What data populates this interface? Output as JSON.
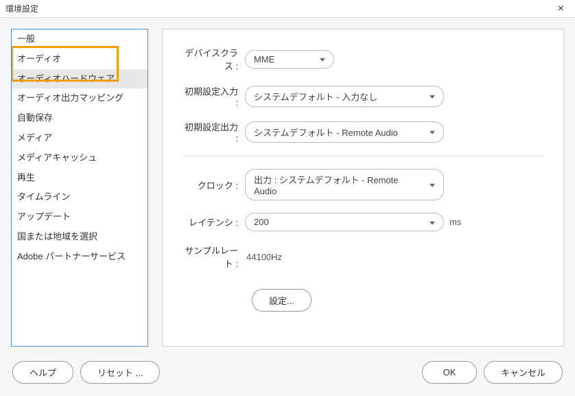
{
  "window": {
    "title": "環境設定"
  },
  "sidebar": {
    "items": [
      {
        "label": "一般"
      },
      {
        "label": "オーディオ"
      },
      {
        "label": "オーディオハードウェア"
      },
      {
        "label": "オーディオ出力マッピング"
      },
      {
        "label": "自動保存"
      },
      {
        "label": "メディア"
      },
      {
        "label": "メディアキャッシュ"
      },
      {
        "label": "再生"
      },
      {
        "label": "タイムライン"
      },
      {
        "label": "アップデート"
      },
      {
        "label": "国または地域を選択"
      },
      {
        "label": "Adobe パートナーサービス"
      }
    ]
  },
  "panel": {
    "deviceClass": {
      "label": "デバイスクラス :",
      "value": "MME"
    },
    "defaultInput": {
      "label": "初期設定入力 :",
      "value": "システムデフォルト - 入力なし"
    },
    "defaultOutput": {
      "label": "初期設定出力 :",
      "value": "システムデフォルト - Remote Audio"
    },
    "clock": {
      "label": "クロック :",
      "value": "出力 : システムデフォルト - Remote Audio"
    },
    "latency": {
      "label": "レイテンシ :",
      "value": "200",
      "unit": "ms"
    },
    "sampleRate": {
      "label": "サンプルレート :",
      "value": "44100Hz"
    },
    "settingsButton": "設定..."
  },
  "footer": {
    "help": "ヘルプ",
    "reset": "リセット ...",
    "ok": "OK",
    "cancel": "キャンセル"
  }
}
